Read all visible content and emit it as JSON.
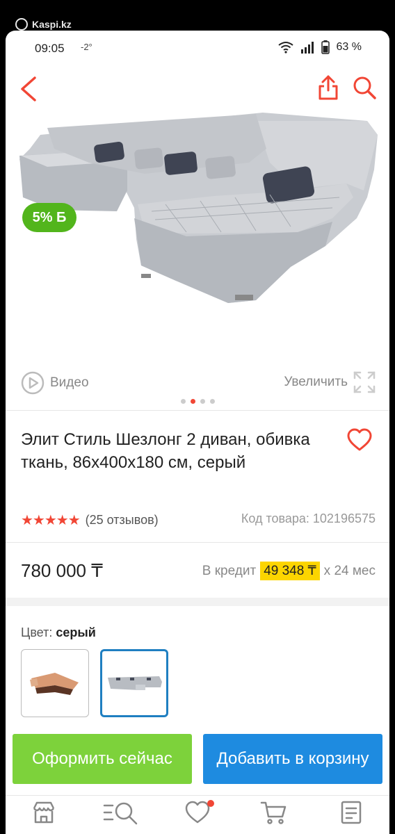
{
  "watermark": "Kaspi.kz",
  "status": {
    "time": "09:05",
    "temp": "-2°",
    "battery": "63 %"
  },
  "nav": {
    "back_icon": "chevron-left-icon",
    "share_icon": "share-icon",
    "search_icon": "search-icon"
  },
  "media": {
    "discount": "5% Б",
    "video_label": "Видео",
    "zoom_label": "Увеличить",
    "slides": 4,
    "active_slide": 1
  },
  "product": {
    "title": "Элит Стиль Шезлонг 2 диван, обивка ткань, 86x400x180 см, серый",
    "stars": "★★★★★",
    "reviews": "(25 отзывов)",
    "sku": "Код товара: 102196575",
    "price": "780 000 ₸",
    "credit_prefix": "В кредит",
    "credit_amount": "49 348 ₸",
    "credit_suffix": "x 24 мес"
  },
  "color": {
    "label": "Цвет:",
    "value": "серый"
  },
  "buttons": {
    "buy_now": "Оформить сейчас",
    "add_to_cart": "Добавить в корзину"
  },
  "colors": {
    "brand_red": "#f14635",
    "green": "#7dd23b",
    "blue": "#1e8be0",
    "yellow": "#fcd500"
  }
}
